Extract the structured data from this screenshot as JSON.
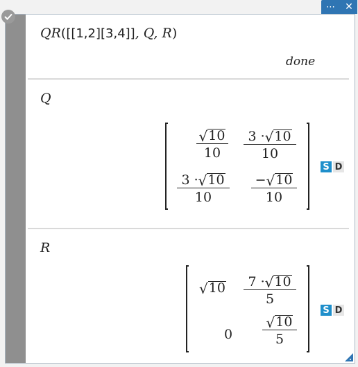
{
  "window_controls": {
    "menu_label": "⋯",
    "close_label": "✕"
  },
  "entry": {
    "func": "QR",
    "open": "(",
    "matrix": "[[1,2][3,4]]",
    "args": ", Q, R",
    "close": ")",
    "status": "done"
  },
  "output_q": {
    "label": "Q",
    "cells": [
      {
        "coef": "",
        "rad": "10",
        "den": "10"
      },
      {
        "coef": "3 · ",
        "rad": "10",
        "den": "10"
      },
      {
        "coef": "3 · ",
        "rad": "10",
        "den": "10"
      },
      {
        "coef": "−",
        "rad": "10",
        "den": "10"
      }
    ],
    "badge_s": "S",
    "badge_d": "D"
  },
  "output_r": {
    "label": "R",
    "cell_11_rad": "10",
    "cell_12": {
      "coef": "7 · ",
      "rad": "10",
      "den": "5"
    },
    "cell_21": "0",
    "cell_22": {
      "coef": "",
      "rad": "10",
      "den": "5"
    },
    "badge_s": "S",
    "badge_d": "D"
  },
  "icons": [
    "check-circle-icon",
    "more-icon",
    "close-icon",
    "resize-grip-icon"
  ]
}
